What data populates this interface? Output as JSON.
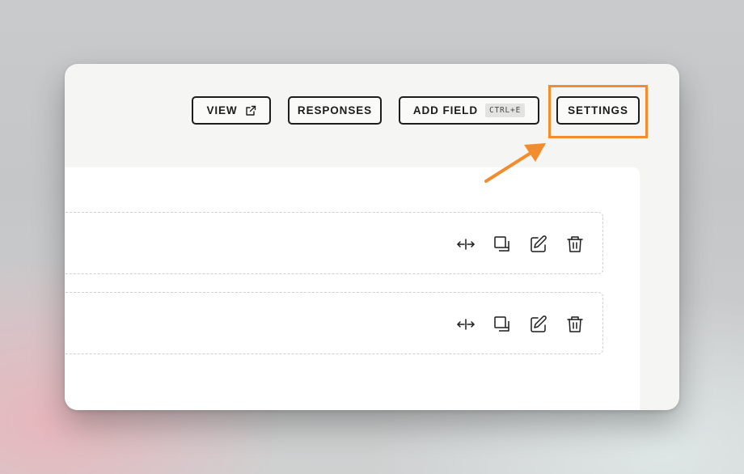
{
  "toolbar": {
    "view_label": "VIEW",
    "responses_label": "RESPONSES",
    "add_field_label": "ADD FIELD",
    "add_field_shortcut": "CTRL+E",
    "settings_label": "SETTINGS"
  },
  "annotation": {
    "highlight_color": "#f28c2c",
    "target": "settings-button"
  },
  "fields": [
    {
      "actions": [
        "resize-width-icon",
        "duplicate-icon",
        "edit-icon",
        "delete-icon"
      ]
    },
    {
      "actions": [
        "resize-width-icon",
        "duplicate-icon",
        "edit-icon",
        "delete-icon"
      ]
    }
  ]
}
